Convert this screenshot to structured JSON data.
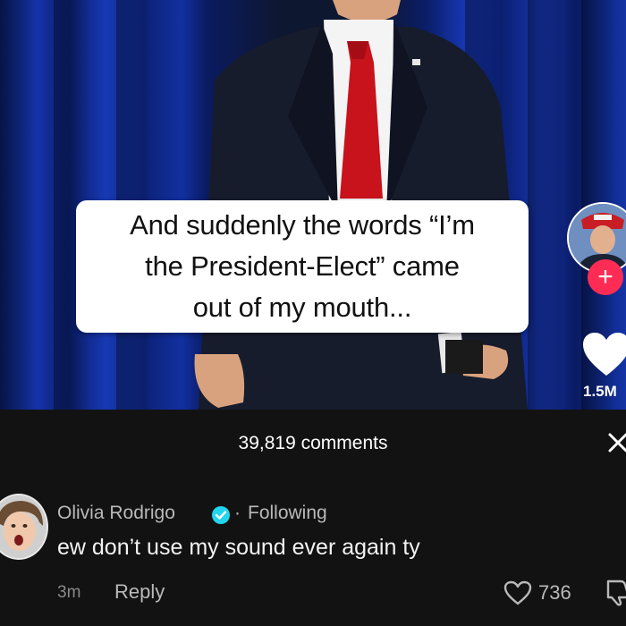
{
  "video": {
    "caption": "And suddenly the words “I’m\nthe President-Elect” came\nout of my mouth...",
    "like_count": "1.5M"
  },
  "comments_sheet": {
    "title": "39,819 comments",
    "comment": {
      "username": "Olivia Rodrigo",
      "separator": "·",
      "following_label": "Following",
      "text": "ew don’t use my sound ever again ty",
      "time": "3m",
      "reply_label": "Reply",
      "like_count": "736"
    }
  },
  "colors": {
    "curtain": "#1533a8",
    "follow_button": "#fe2c55",
    "verified": "#20d5ec",
    "sheet_background": "#121212"
  },
  "icons": [
    "follow-plus-icon",
    "heart-icon",
    "close-icon",
    "verified-badge-icon",
    "heart-outline-icon",
    "dislike-icon"
  ]
}
